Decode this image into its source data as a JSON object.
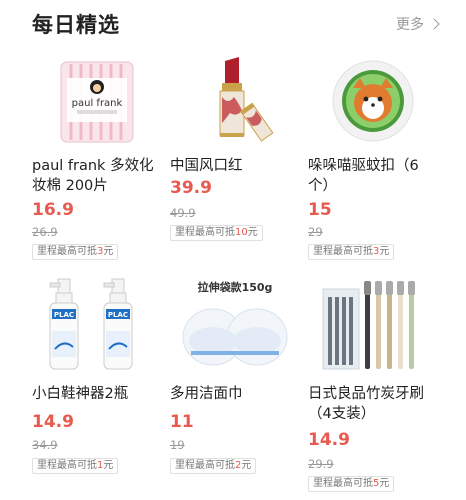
{
  "header": {
    "title": "每日精选",
    "more": "更多"
  },
  "products": [
    {
      "name": "paul frank 多效化妆棉 200片",
      "price": "16.9",
      "original": "26.9",
      "badge_prefix": "里程最高可抵",
      "badge_amount": "3",
      "badge_unit": "元",
      "image_text": "paul frank"
    },
    {
      "name": "中国风口红",
      "price": "39.9",
      "original": "49.9",
      "badge_prefix": "里程最高可抵",
      "badge_amount": "10",
      "badge_unit": "元"
    },
    {
      "name": "哚哚喵驱蚊扣（6个）",
      "price": "15",
      "original": "29",
      "badge_prefix": "里程最高可抵",
      "badge_amount": "3",
      "badge_unit": "元"
    },
    {
      "name": "小白鞋神器2瓶",
      "price": "14.9",
      "original": "34.9",
      "badge_prefix": "里程最高可抵",
      "badge_amount": "1",
      "badge_unit": "元",
      "image_text": "PLAC"
    },
    {
      "name": "多用洁面巾",
      "price": "11",
      "original": "19",
      "badge_prefix": "里程最高可抵",
      "badge_amount": "2",
      "badge_unit": "元",
      "image_text": "拉伸袋款150g"
    },
    {
      "name": "日式良品竹炭牙刷（4支装）",
      "price": "14.9",
      "original": "29.9",
      "badge_prefix": "里程最高可抵",
      "badge_amount": "5",
      "badge_unit": "元"
    }
  ],
  "colors": {
    "price": "#e85a4f",
    "badge_amount": "#e85a4f"
  }
}
